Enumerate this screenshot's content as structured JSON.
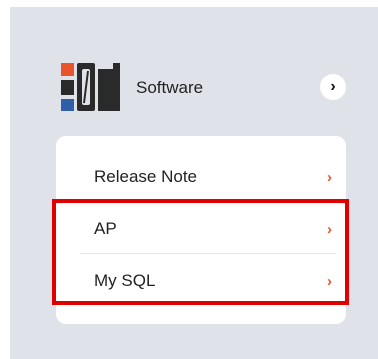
{
  "header": {
    "title": "Software",
    "logo_icon": "software-brand-logo",
    "arrow_icon": "chevron-right-icon"
  },
  "menu": {
    "items": [
      {
        "label": "Release Note",
        "icon": "chevron-right-icon"
      },
      {
        "label": "AP",
        "icon": "chevron-right-icon"
      },
      {
        "label": "My SQL",
        "icon": "chevron-right-icon"
      }
    ],
    "chevron_color": "#e8552a"
  },
  "highlight": {
    "color": "#e00000",
    "covers": [
      "AP",
      "My SQL"
    ]
  },
  "colors": {
    "panel_bg": "#dfe2e8",
    "card_bg": "#ffffff"
  }
}
